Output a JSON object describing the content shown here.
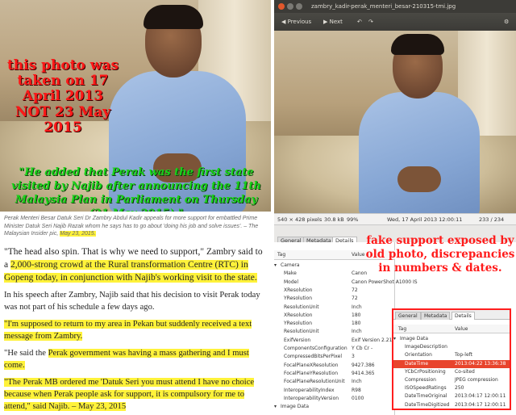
{
  "overlay": {
    "photo_date": "this photo was taken on 17 April 2013",
    "not_date": "NOT 23 May 2015",
    "quote": "\"He added that Perak was the first state visited by Najib after announcing the 11th Malaysia Plan in Parliament on Thursday (21 May 2015).\"",
    "fake_note": "fake support exposed by old photo, discrepancies in numbers & dates."
  },
  "caption": {
    "text": "Perak Menteri Besar Datuk Seri Dr Zambry Abdul Kadir appeals for more support for embattled Prime Minister Datuk Seri Najib Razak whom he says has to go about 'doing his job and solve issues'. – The Malaysian Insider pic,",
    "date": "May 23, 2015."
  },
  "article": {
    "p1_a": "\"The head also spin. That is why we need to support,\" Zambry said to a ",
    "p1_hl": "2,000-strong crowd at the Rural transformation Centre (RTC) in Gopeng today, in conjunction with Najib's working visit to the state.",
    "p2": "In his speech after Zambry, Najib said that his decision to visit Perak today was not part of his schedule a few days ago.",
    "p3_hl": "\"I'm supposed to return to my area in Pekan but suddenly received a text message from Zambry.",
    "p4_a": "\"He said the ",
    "p4_hl": "Perak government was having a mass gathering and I must come.",
    "p5_hl": "\"The Perak MB ordered me 'Datuk Seri you must attend I have no choice because when Perak people ask for support, it is compulsory for me to attend,\" said Najib. – May 23, 2015"
  },
  "viewer": {
    "title": "zambry_kadir-perak_menteri_besar-210315-tmi.jpg",
    "prev_label": "Previous",
    "next_label": "Next",
    "status_dims": "540 × 428 pixels",
    "status_size": "30.8 kB",
    "status_zoom": "99%",
    "status_date": "Wed, 17 April 2013  12:00:11",
    "status_count": "233 / 234",
    "tabs": [
      "General",
      "Metadata",
      "Details"
    ]
  },
  "meta": {
    "col_tag": "Tag",
    "col_value": "Value",
    "rows": [
      {
        "k": "Camera",
        "v": "",
        "grp": true
      },
      {
        "k": "Make",
        "v": "Canon"
      },
      {
        "k": "Model",
        "v": "Canon PowerShot A1000 IS"
      },
      {
        "k": "XResolution",
        "v": "72"
      },
      {
        "k": "YResolution",
        "v": "72"
      },
      {
        "k": "ResolutionUnit",
        "v": "Inch"
      },
      {
        "k": "XResolution",
        "v": "180"
      },
      {
        "k": "YResolution",
        "v": "180"
      },
      {
        "k": "ResolutionUnit",
        "v": "Inch"
      },
      {
        "k": "ExifVersion",
        "v": "Exif Version 2.21"
      },
      {
        "k": "ComponentsConfiguration",
        "v": "Y Cb Cr -"
      },
      {
        "k": "CompressedBitsPerPixel",
        "v": "3"
      },
      {
        "k": "FocalPlaneXResolution",
        "v": "9427.386"
      },
      {
        "k": "FocalPlaneYResolution",
        "v": "9414.365"
      },
      {
        "k": "FocalPlaneResolutionUnit",
        "v": "Inch"
      },
      {
        "k": "InteroperabilityIndex",
        "v": "R98"
      },
      {
        "k": "InteroperabilityVersion",
        "v": "0100"
      },
      {
        "k": "Image Data",
        "v": "",
        "grp": true
      }
    ]
  },
  "inset": {
    "tabs": [
      "General",
      "Metadata",
      "Details"
    ],
    "col_tag": "Tag",
    "col_value": "Value",
    "rows": [
      {
        "k": "Image Data",
        "v": "",
        "grp": true
      },
      {
        "k": "ImageDescription",
        "v": ""
      },
      {
        "k": "Orientation",
        "v": "Top-left"
      },
      {
        "k": "DateTime",
        "v": "2013:04:22 13:36:38",
        "sel": true
      },
      {
        "k": "YCbCrPositioning",
        "v": "Co-sited"
      },
      {
        "k": "Compression",
        "v": "JPEG compression"
      },
      {
        "k": "ISOSpeedRatings",
        "v": "250"
      },
      {
        "k": "DateTimeOriginal",
        "v": "2013:04:17 12:00:11"
      },
      {
        "k": "DateTimeDigitized",
        "v": "2013:04:17 12:00:11"
      }
    ]
  },
  "colors": {
    "overlay_red": "#ff1818",
    "overlay_green": "#18d318",
    "highlight": "#fff23a",
    "inset_border": "#ff1f1f",
    "selected_row": "#e8442c"
  }
}
